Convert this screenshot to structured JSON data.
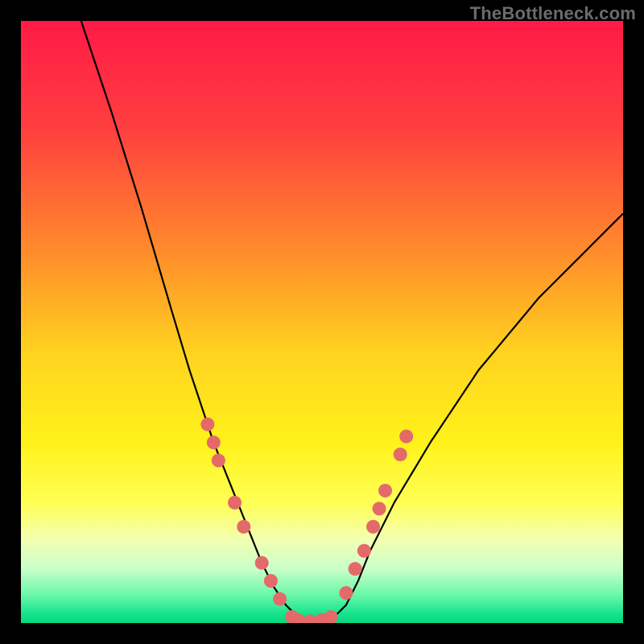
{
  "watermark": "TheBottleneck.com",
  "colors": {
    "black": "#000000",
    "curve": "#000000",
    "dot_fill": "#e46a6a",
    "dot_stroke": "#c45050",
    "gradient_stops": [
      {
        "offset": 0.0,
        "color": "#ff1a47"
      },
      {
        "offset": 0.18,
        "color": "#ff3f3f"
      },
      {
        "offset": 0.38,
        "color": "#ff8a2b"
      },
      {
        "offset": 0.55,
        "color": "#ffd21f"
      },
      {
        "offset": 0.7,
        "color": "#fff21a"
      },
      {
        "offset": 0.8,
        "color": "#ffff55"
      },
      {
        "offset": 0.86,
        "color": "#f4ffb0"
      },
      {
        "offset": 0.91,
        "color": "#c9ffc9"
      },
      {
        "offset": 0.955,
        "color": "#66f7a8"
      },
      {
        "offset": 0.985,
        "color": "#16e28c"
      },
      {
        "offset": 1.0,
        "color": "#07d97f"
      }
    ]
  },
  "chart_data": {
    "type": "line",
    "title": "",
    "xlabel": "",
    "ylabel": "",
    "xlim": [
      0,
      100
    ],
    "ylim": [
      0,
      100
    ],
    "grid": false,
    "legend": false,
    "note": "V-shaped bottleneck curve; y ≈ mismatch %, minimum (~0) near x≈45–50. Values estimated from pixel heights.",
    "series": [
      {
        "name": "bottleneck-curve",
        "x": [
          10,
          15,
          20,
          25,
          28,
          30,
          32,
          34,
          36,
          38,
          40,
          42,
          44,
          46,
          48,
          50,
          52,
          54,
          56,
          58,
          62,
          68,
          76,
          86,
          100
        ],
        "y": [
          100,
          85,
          69,
          52,
          42,
          36,
          30,
          25,
          20,
          15,
          10,
          6,
          3,
          1,
          0,
          0,
          1,
          3,
          7,
          12,
          20,
          30,
          42,
          54,
          68
        ]
      }
    ],
    "markers": {
      "name": "highlight-dots",
      "note": "salmon dots clustered on both arms near the trough",
      "points": [
        {
          "x": 31.0,
          "y": 33
        },
        {
          "x": 32.0,
          "y": 30
        },
        {
          "x": 32.8,
          "y": 27
        },
        {
          "x": 35.5,
          "y": 20
        },
        {
          "x": 37.0,
          "y": 16
        },
        {
          "x": 40.0,
          "y": 10
        },
        {
          "x": 41.5,
          "y": 7
        },
        {
          "x": 43.0,
          "y": 4
        },
        {
          "x": 45.0,
          "y": 1
        },
        {
          "x": 46.0,
          "y": 0.5
        },
        {
          "x": 48.0,
          "y": 0.3
        },
        {
          "x": 50.0,
          "y": 0.5
        },
        {
          "x": 51.5,
          "y": 1
        },
        {
          "x": 54.0,
          "y": 5
        },
        {
          "x": 55.5,
          "y": 9
        },
        {
          "x": 57.0,
          "y": 12
        },
        {
          "x": 58.5,
          "y": 16
        },
        {
          "x": 59.5,
          "y": 19
        },
        {
          "x": 60.5,
          "y": 22
        },
        {
          "x": 63.0,
          "y": 28
        },
        {
          "x": 64.0,
          "y": 31
        }
      ]
    }
  }
}
